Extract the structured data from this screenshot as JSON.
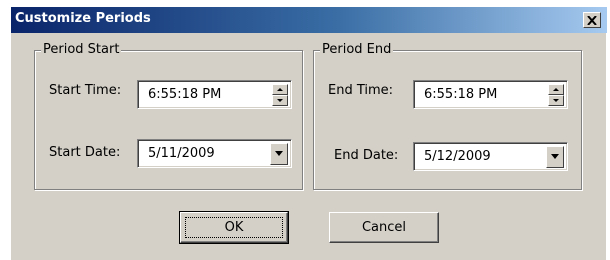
{
  "window": {
    "title": "Customize Periods",
    "close_glyph": "×"
  },
  "period_start": {
    "legend": "Period Start",
    "time_label": "Start Time:",
    "time_value": "6:55:18 PM",
    "date_label": "Start Date:",
    "date_value": "5/11/2009"
  },
  "period_end": {
    "legend": "Period End",
    "time_label": "End Time:",
    "time_value": "6:55:18 PM",
    "date_label": "End Date:",
    "date_value": "5/12/2009"
  },
  "buttons": {
    "ok_label": "OK",
    "cancel_label": "Cancel"
  },
  "colors": {
    "dialog_face": "#d4d0c8",
    "titlebar_start": "#0a246a",
    "titlebar_end": "#a6caf0"
  }
}
